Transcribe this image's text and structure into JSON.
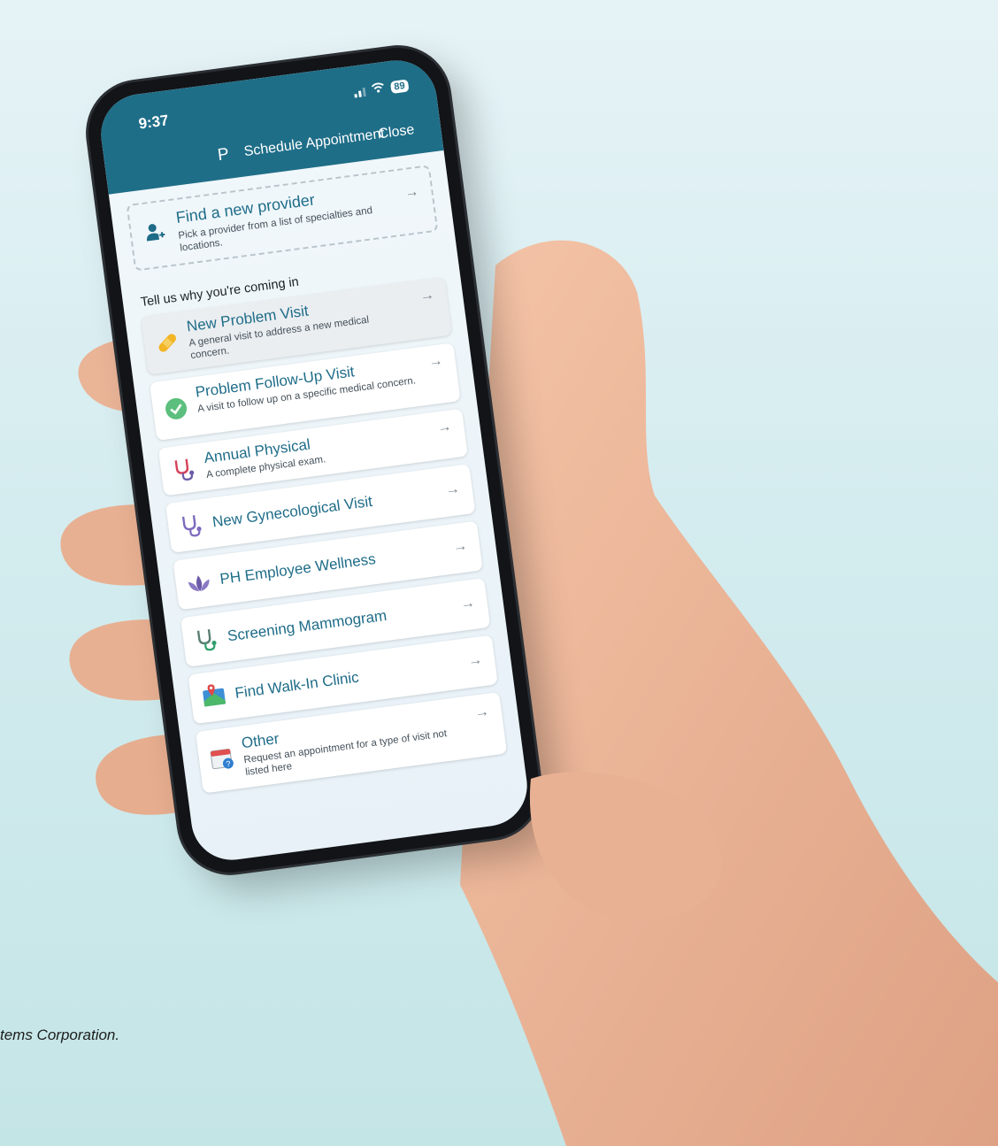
{
  "status": {
    "time": "9:37",
    "battery": "89"
  },
  "nav": {
    "letter": "P",
    "title": "Schedule Appointment",
    "close": "Close"
  },
  "provider": {
    "title": "Find a new provider",
    "subtitle": "Pick a provider from a list of specialties and locations.",
    "icon": "add-person-icon"
  },
  "section_title": "Tell us why you're coming in",
  "visits": [
    {
      "title": "New Problem Visit",
      "subtitle": "A general visit to address a new medical concern.",
      "icon": "bandage-icon",
      "selected": true
    },
    {
      "title": "Problem Follow-Up Visit",
      "subtitle": "A visit to follow up on a specific medical concern.",
      "icon": "check-circle-icon",
      "selected": false
    },
    {
      "title": "Annual Physical",
      "subtitle": "A complete physical exam.",
      "icon": "stethoscope-red-icon",
      "selected": false
    },
    {
      "title": "New Gynecological Visit",
      "subtitle": "",
      "icon": "stethoscope-purple-icon",
      "selected": false
    },
    {
      "title": "PH Employee Wellness",
      "subtitle": "",
      "icon": "lotus-icon",
      "selected": false
    },
    {
      "title": "Screening Mammogram",
      "subtitle": "",
      "icon": "stethoscope-green-icon",
      "selected": false
    },
    {
      "title": "Find Walk-In Clinic",
      "subtitle": "",
      "icon": "map-pin-icon",
      "selected": false
    },
    {
      "title": "Other",
      "subtitle": "Request an appointment for a type of visit not listed here",
      "icon": "calendar-question-icon",
      "selected": false
    }
  ],
  "caption": "tems Corporation.",
  "colors": {
    "header": "#1f6e88",
    "accent": "#1e6c88",
    "background": "#d4ecef"
  }
}
